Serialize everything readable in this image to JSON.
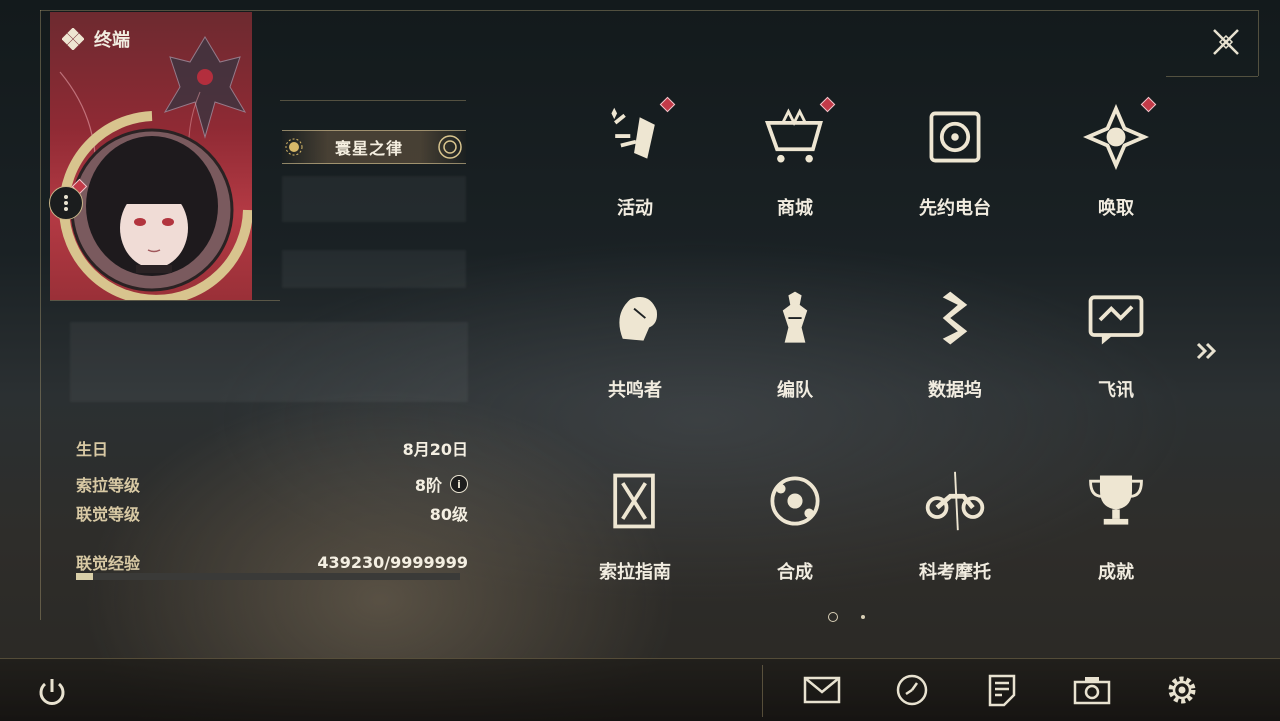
{
  "header": {
    "title": "终端"
  },
  "profile": {
    "nameplate": "寰星之律",
    "birthday_label": "生日",
    "birthday_value": "8月20日",
    "sola_level_label": "索拉等级",
    "sola_level_value": "8阶",
    "union_level_label": "联觉等级",
    "union_level_value": "80级",
    "exp_label": "联觉经验",
    "exp_value": "439230/9999999",
    "exp_progress": 0.044
  },
  "menu": [
    {
      "label": "活动",
      "icon": "events-icon",
      "badge": true
    },
    {
      "label": "商城",
      "icon": "shop-cart-icon",
      "badge": true
    },
    {
      "label": "先约电台",
      "icon": "radio-icon",
      "badge": false
    },
    {
      "label": "唤取",
      "icon": "convene-icon",
      "badge": true
    },
    {
      "label": "共鸣者",
      "icon": "resonator-icon",
      "badge": false
    },
    {
      "label": "编队",
      "icon": "team-chess-icon",
      "badge": false
    },
    {
      "label": "数据坞",
      "icon": "data-bank-icon",
      "badge": false
    },
    {
      "label": "飞讯",
      "icon": "chat-message-icon",
      "badge": false
    },
    {
      "label": "索拉指南",
      "icon": "guide-book-icon",
      "badge": false
    },
    {
      "label": "合成",
      "icon": "synthesis-icon",
      "badge": false
    },
    {
      "label": "科考摩托",
      "icon": "motorcycle-icon",
      "badge": false
    },
    {
      "label": "成就",
      "icon": "trophy-icon",
      "badge": false
    }
  ],
  "pagination": {
    "current": 1,
    "total": 2
  },
  "bottom_bar": [
    "power-icon",
    "mail-icon",
    "clock-icon",
    "notes-icon",
    "camera-icon",
    "settings-gear-icon"
  ],
  "colors": {
    "accent_gold": "#c9b78a",
    "badge_red": "#c23a48",
    "text_light": "#f1ece0"
  }
}
